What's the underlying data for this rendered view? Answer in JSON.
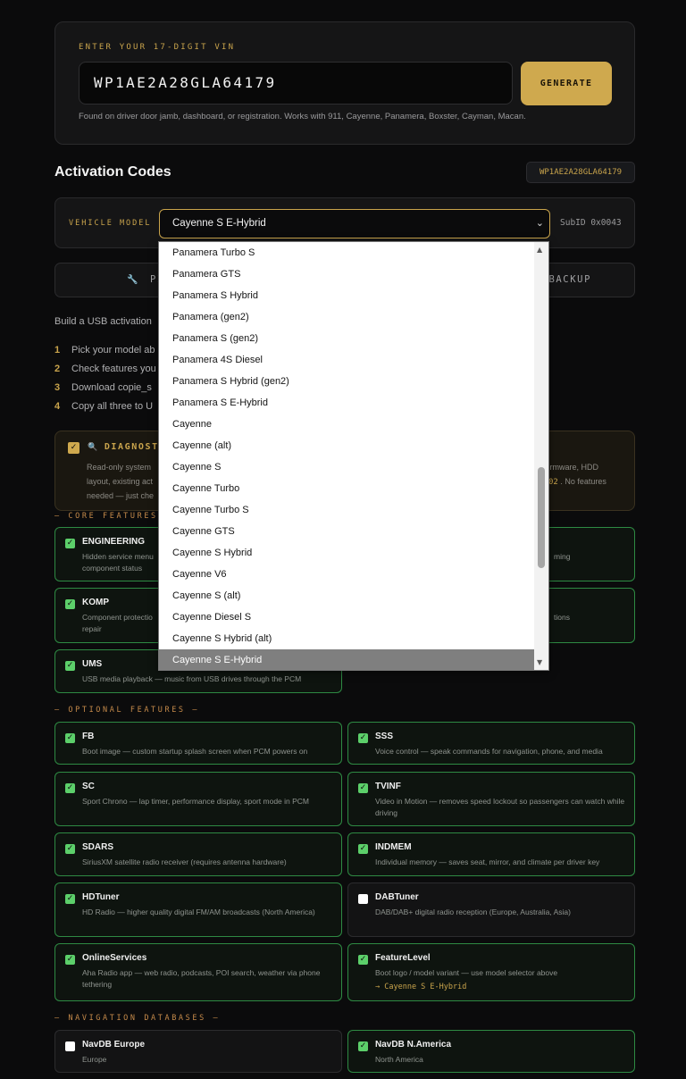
{
  "vin": {
    "label": "ENTER YOUR 17-DIGIT VIN",
    "value": "WP1AE2A28GLA64179",
    "generate_label": "GENERATE",
    "hint": "Found on driver door jamb, dashboard, or registration. Works with 911, Cayenne, Panamera, Boxster, Cayman, Macan."
  },
  "codes": {
    "title": "Activation Codes",
    "vin_badge": "WP1AE2A28GLA64179"
  },
  "model": {
    "label": "VEHICLE MODEL",
    "selected": "Cayenne S E-Hybrid",
    "subid": "SubID 0x0043",
    "options": [
      "Panamera Turbo S",
      "Panamera GTS",
      "Panamera S Hybrid",
      "Panamera (gen2)",
      "Panamera S (gen2)",
      "Panamera 4S Diesel",
      "Panamera S Hybrid (gen2)",
      "Panamera S E-Hybrid",
      "Cayenne",
      "Cayenne (alt)",
      "Cayenne S",
      "Cayenne Turbo",
      "Cayenne Turbo S",
      "Cayenne GTS",
      "Cayenne S Hybrid",
      "Cayenne V6",
      "Cayenne S (alt)",
      "Cayenne Diesel S",
      "Cayenne S Hybrid (alt)",
      "Cayenne S E-Hybrid"
    ]
  },
  "modes": {
    "left_icon": "🔧",
    "left_label": "PI",
    "right_label": "BACKUP"
  },
  "intro": "Build a USB activation",
  "steps": [
    {
      "num": "1",
      "text": "Pick your model ab"
    },
    {
      "num": "2",
      "text": "Check features you"
    },
    {
      "num": "3",
      "text": "Download copie_s"
    },
    {
      "num": "4",
      "text": "Copy all three to U"
    }
  ],
  "diagnostic": {
    "icon": "🔍",
    "title": "DIAGNOSTIC",
    "desc_left": [
      "Read-only system",
      "layout, existing act",
      "needed — just che"
    ],
    "desc_right_1": "firmware, HDD",
    "desc_right_2_code": "02",
    "desc_right_2_tail": ". No features"
  },
  "sections": {
    "core": "— CORE FEATURES —",
    "optional": "— OPTIONAL FEATURES —",
    "nav": "— NAVIGATION DATABASES —"
  },
  "core_features": [
    {
      "name": "ENGINEERING",
      "desc": "Hidden service menu",
      "desc2": "component status",
      "right_desc": "ming",
      "checked": true
    },
    {
      "name": "KOMP",
      "desc": "Component protectio",
      "desc2": "repair",
      "right_desc": "tions",
      "checked": true
    },
    {
      "name": "UMS",
      "desc": "USB media playback — music from USB drives through the PCM",
      "checked": true
    }
  ],
  "optional_features": [
    {
      "name": "FB",
      "desc": "Boot image — custom startup splash screen when PCM powers on",
      "checked": true
    },
    {
      "name": "SSS",
      "desc": "Voice control — speak commands for navigation, phone, and media",
      "checked": true
    },
    {
      "name": "SC",
      "desc": "Sport Chrono — lap timer, performance display, sport mode in PCM",
      "checked": true
    },
    {
      "name": "TVINF",
      "desc": "Video in Motion — removes speed lockout so passengers can watch while driving",
      "checked": true
    },
    {
      "name": "SDARS",
      "desc": "SiriusXM satellite radio receiver (requires antenna hardware)",
      "checked": true
    },
    {
      "name": "INDMEM",
      "desc": "Individual memory — saves seat, mirror, and climate per driver key",
      "checked": true
    },
    {
      "name": "HDTuner",
      "desc": "HD Radio — higher quality digital FM/AM broadcasts (North America)",
      "checked": true
    },
    {
      "name": "DABTuner",
      "desc": "DAB/DAB+ digital radio reception (Europe, Australia, Asia)",
      "checked": false
    },
    {
      "name": "OnlineServices",
      "desc": "Aha Radio app — web radio, podcasts, POI search, weather via phone tethering",
      "checked": true
    },
    {
      "name": "FeatureLevel",
      "desc": "Boot logo / model variant — use model selector above",
      "extra": "→ Cayenne S E-Hybrid",
      "checked": true
    }
  ],
  "nav_dbs": [
    {
      "name": "NavDB Europe",
      "desc": "Europe",
      "checked": false
    },
    {
      "name": "NavDB N.America",
      "desc": "North America",
      "checked": true
    }
  ],
  "checkmark": "✓",
  "scroll": {
    "up": "▲",
    "down": "▼"
  },
  "chevron": "⌄",
  "colors": {
    "accent": "#c9a44c",
    "enabled_border": "#2e8a43",
    "check_green": "#5ccf6a"
  }
}
